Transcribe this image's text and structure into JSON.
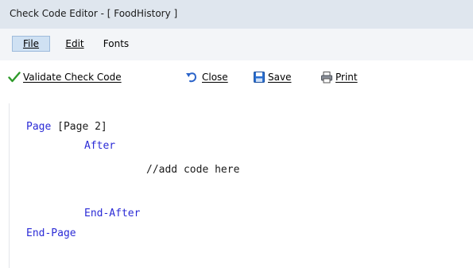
{
  "window": {
    "title": "Check Code Editor - [ FoodHistory ]"
  },
  "menu": [
    {
      "label": "File"
    },
    {
      "label": "Edit"
    },
    {
      "label": "Fonts"
    }
  ],
  "toolbar": {
    "validate": {
      "label": "Validate Check Code",
      "icon": "checkmark-icon"
    },
    "close": {
      "label": "Close",
      "icon": "undo-arrow-icon"
    },
    "save": {
      "label": "Save",
      "icon": "floppy-disk-icon"
    },
    "print": {
      "label": "Print",
      "icon": "printer-icon"
    }
  },
  "editor": {
    "lines": [
      {
        "keyword": "Page",
        "text": " [Page 2]"
      },
      {
        "keyword": "After",
        "text": ""
      },
      {
        "keyword": "",
        "text": "//add code here"
      },
      {
        "keyword": "End-After",
        "text": ""
      },
      {
        "keyword": "End-Page",
        "text": ""
      }
    ]
  },
  "colors": {
    "keyword": "#2b2bd6",
    "titlebar": "#dfe6ee",
    "menubar": "#f3f5f8",
    "menu_active": "#cfe1f3",
    "check_green": "#2e9a2a"
  }
}
